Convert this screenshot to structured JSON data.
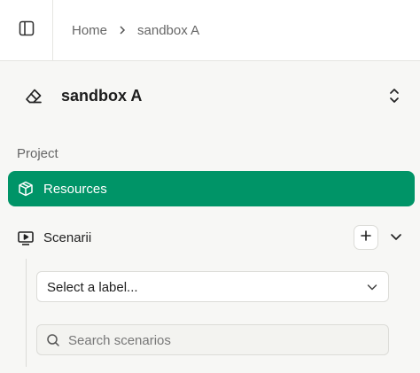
{
  "header": {
    "toggle_icon": "sidebar-toggle-icon",
    "breadcrumb": [
      "Home",
      "sandbox A"
    ]
  },
  "workspace": {
    "name": "sandbox A",
    "icon": "eraser-icon",
    "switch_icon": "chevron-up-down-icon"
  },
  "nav": {
    "section_label": "Project",
    "active_item": {
      "label": "Resources",
      "icon": "box-icon"
    },
    "scenarii": {
      "label": "Scenarii",
      "icon": "presentation-play-icon",
      "add_icon": "plus-icon",
      "expand_icon": "chevron-down-icon"
    }
  },
  "filters": {
    "label_select": "Select a label...",
    "search_placeholder": "Search scenarios"
  },
  "colors": {
    "accent": "#009467",
    "background": "#f7f7f5"
  }
}
